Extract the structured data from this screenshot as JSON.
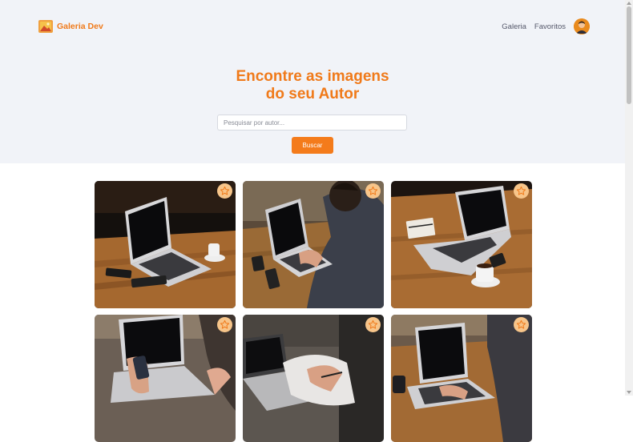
{
  "brand": {
    "name": "Galeria Dev",
    "icon": "gallery-logo-icon"
  },
  "nav": {
    "gallery": "Galeria",
    "favorites": "Favoritos"
  },
  "hero": {
    "title_line1": "Encontre as imagens",
    "title_line2": "do seu Autor",
    "search_placeholder": "Pesquisar por autor...",
    "search_button": "Buscar"
  },
  "colors": {
    "accent": "#f07a1a",
    "hero_bg": "#f1f3f8",
    "star_bg": "#f7c58a"
  },
  "gallery": {
    "cards": [
      {
        "photo": "laptop-on-table",
        "favorite_icon": "star-icon"
      },
      {
        "photo": "person-typing-laptop",
        "favorite_icon": "star-icon"
      },
      {
        "photo": "laptop-with-coffee",
        "favorite_icon": "star-icon"
      },
      {
        "photo": "hand-with-phone-laptop",
        "favorite_icon": "star-icon"
      },
      {
        "photo": "writing-at-laptop",
        "favorite_icon": "star-icon"
      },
      {
        "photo": "typing-on-laptop",
        "favorite_icon": "star-icon"
      }
    ]
  }
}
